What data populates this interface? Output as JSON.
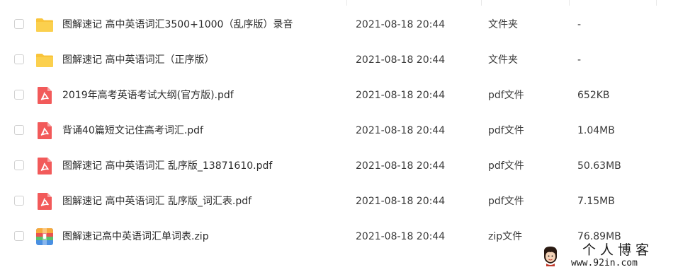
{
  "colors": {
    "folder": "#F9C43A",
    "pdf": "#F25A5A",
    "zip_blue": "#4A90E2",
    "zip_green": "#5BC26A",
    "zip_orange": "#F7A93B",
    "zip_red": "#E9534F"
  },
  "files": [
    {
      "icon": "folder-icon",
      "name": "图解速记 高中英语词汇3500+1000（乱序版）录音",
      "date": "2021-08-18 20:44",
      "type": "文件夹",
      "size": "-"
    },
    {
      "icon": "folder-icon",
      "name": "图解速记 高中英语词汇（正序版）",
      "date": "2021-08-18 20:44",
      "type": "文件夹",
      "size": "-"
    },
    {
      "icon": "pdf-icon",
      "name": "2019年高考英语考试大纲(官方版).pdf",
      "date": "2021-08-18 20:44",
      "type": "pdf文件",
      "size": "652KB"
    },
    {
      "icon": "pdf-icon",
      "name": "背诵40篇短文记住高考词汇.pdf",
      "date": "2021-08-18 20:44",
      "type": "pdf文件",
      "size": "1.04MB"
    },
    {
      "icon": "pdf-icon",
      "name": "图解速记  高中英语词汇  乱序版_13871610.pdf",
      "date": "2021-08-18 20:44",
      "type": "pdf文件",
      "size": "50.63MB"
    },
    {
      "icon": "pdf-icon",
      "name": "图解速记  高中英语词汇  乱序版_词汇表.pdf",
      "date": "2021-08-18 20:44",
      "type": "pdf文件",
      "size": "7.15MB"
    },
    {
      "icon": "zip-icon",
      "name": "图解速记高中英语词汇单词表.zip",
      "date": "2021-08-18 20:44",
      "type": "zip文件",
      "size": "76.89MB"
    }
  ],
  "watermark": {
    "title": "个人博客",
    "url": "www.92in.com"
  }
}
